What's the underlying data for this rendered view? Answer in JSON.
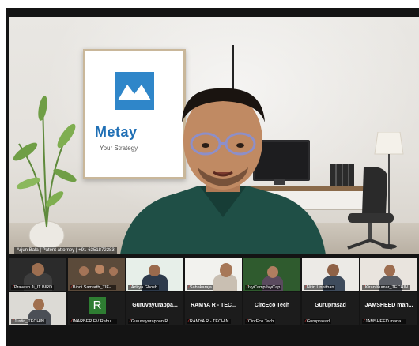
{
  "main_speaker": {
    "name_label": "Arjun Bala | Patent attorney | +91-6351872283",
    "poster_brand": "Metay",
    "poster_tagline": "Your Strategy"
  },
  "participants_row1": [
    {
      "label": "Pravesh Ji_IT BIRD"
    },
    {
      "label": "Bindi Samarth_TIE-..."
    },
    {
      "label": "Aditya Ghosh"
    },
    {
      "label": "Sahakaraja"
    },
    {
      "label": "IvyCamp IvyCap"
    },
    {
      "label": "Nitin Unnithan"
    },
    {
      "label": "Kiran Kumar_TECHIN"
    }
  ],
  "participants_row2": [
    {
      "label": "Justin_TECHIN",
      "title": ""
    },
    {
      "label": "INARBER EV Rahul...",
      "title": "",
      "avatar": "R"
    },
    {
      "label": "Guruvayurappan R",
      "title": "Guruvayurappa..."
    },
    {
      "label": "RAMYA R - TECHIN",
      "title": "RAMYA R - TEC..."
    },
    {
      "label": "CircEco Tech",
      "title": "CircEco Tech"
    },
    {
      "label": "Guruprasad",
      "title": "Guruprasad"
    },
    {
      "label": "JAMSHEED mana...",
      "title": "JAMSHEED man..."
    }
  ],
  "colors": {
    "brand_blue": "#1f6fb5",
    "mic_muted": "#e23b3b",
    "avatar_green": "#2e7d32"
  }
}
